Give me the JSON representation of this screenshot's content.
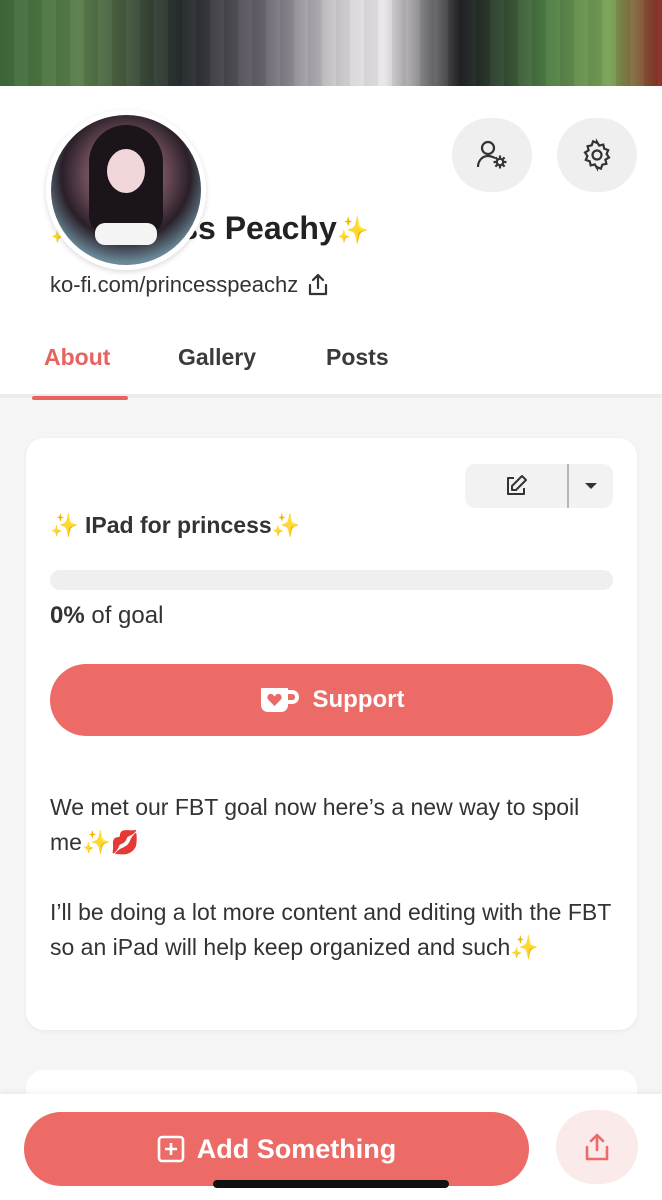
{
  "profile": {
    "name_sparkle_left": "✨",
    "name": "Princess Peachy",
    "name_sparkle_right": "✨",
    "url": "ko-fi.com/princesspeachz"
  },
  "tabs": [
    {
      "label": "About",
      "active": true
    },
    {
      "label": "Gallery",
      "active": false
    },
    {
      "label": "Posts",
      "active": false
    }
  ],
  "goal": {
    "sparkle_left": "✨",
    "title": "IPad for princess",
    "sparkle_right": "✨",
    "progress_percent": 0,
    "percent_text": "0%",
    "goal_suffix": "of goal",
    "support_label": "Support",
    "description_p1": "We met our FBT goal now here’s a new way to spoil me✨💋",
    "description_p2": "I’ll be doing a lot more content and editing with the FBT so an iPad will help keep organized and such✨"
  },
  "bottom": {
    "add_label": "Add Something"
  },
  "icons": {
    "manage-user": "user-gear-icon",
    "settings": "gear-icon",
    "share": "share-icon",
    "edit": "edit-icon",
    "dropdown": "caret-down-icon",
    "kofi": "kofi-cup-icon",
    "add": "plus-square-icon"
  },
  "colors": {
    "accent": "#e8625f",
    "button": "#ec6b66",
    "share_bg": "#fbeaea"
  }
}
